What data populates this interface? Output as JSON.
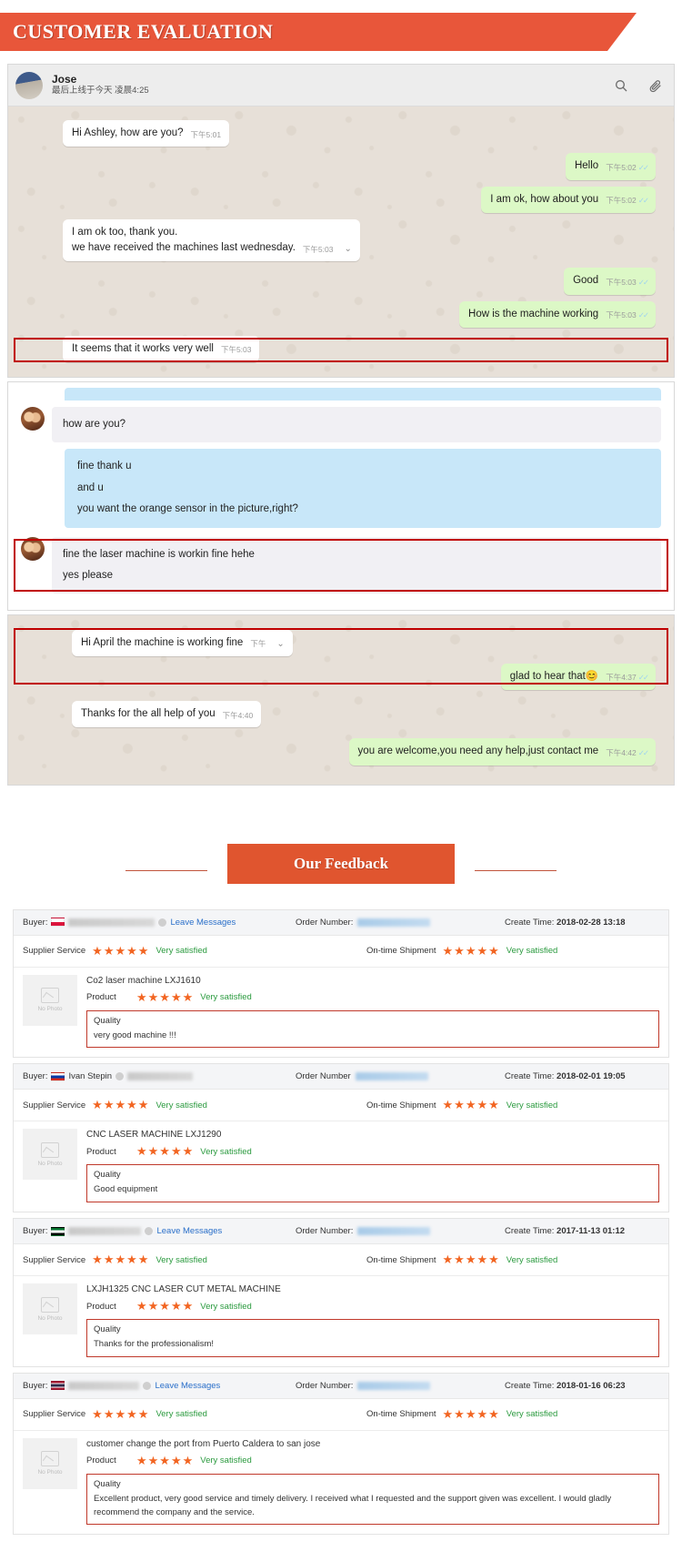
{
  "banner": {
    "title": "CUSTOMER EVALUATION"
  },
  "chat1": {
    "header": {
      "name": "Jose",
      "status": "最后上线于今天 凌晨4:25",
      "search_icon": "search-icon",
      "attach_icon": "paperclip-icon"
    },
    "messages": [
      {
        "side": "in",
        "text": "Hi Ashley, how are you?",
        "time": "下午5:01",
        "ticks": ""
      },
      {
        "side": "out",
        "text": "Hello",
        "time": "下午5:02",
        "ticks": "✓✓"
      },
      {
        "side": "out",
        "text": "I am ok, how about you",
        "time": "下午5:02",
        "ticks": "✓✓"
      },
      {
        "side": "in",
        "text": "I am ok too, thank you.\nwe have received the machines last wednesday.",
        "time": "下午5:03",
        "ticks": "",
        "chevron": "⌄"
      },
      {
        "side": "out",
        "text": "Good",
        "time": "下午5:03",
        "ticks": "✓✓"
      },
      {
        "side": "out",
        "text": "How is the machine working",
        "time": "下午5:03",
        "ticks": "✓✓"
      },
      {
        "side": "in",
        "text": "It seems that it works very well",
        "time": "下午5:03",
        "ticks": "",
        "highlight": true
      }
    ]
  },
  "chat2": {
    "messages": [
      {
        "side": "in",
        "text": "how are you?"
      },
      {
        "side": "out",
        "text": "fine thank u\nand u\nyou want the orange sensor in the picture,right?"
      },
      {
        "side": "in",
        "text": "fine the laser machine is workin fine hehe\nyes please",
        "highlight": true
      }
    ]
  },
  "chat3": {
    "messages": [
      {
        "side": "in",
        "text": "Hi April the machine is working fine",
        "time": "下午",
        "ticks": "",
        "chevron": "⌄",
        "highlight": true
      },
      {
        "side": "out",
        "text": "glad to hear that😊",
        "time": "下午4:37",
        "ticks": "✓✓"
      },
      {
        "side": "in",
        "text": "Thanks for the all help of you",
        "time": "下午4:40",
        "ticks": ""
      },
      {
        "side": "out",
        "text": "you are welcome,you need any help,just contact me",
        "time": "下午4:42",
        "ticks": "✓✓"
      }
    ]
  },
  "feedback_heading": {
    "title": "Our Feedback"
  },
  "labels": {
    "buyer": "Buyer:",
    "leave_messages": "Leave Messages",
    "order_number": "Order Number:",
    "order_number_alt": "Order Number",
    "create_time": "Create Time:",
    "supplier_service": "Supplier Service",
    "on_time_shipment": "On-time Shipment",
    "product": "Product",
    "quality": "Quality",
    "no_photo": "No Photo",
    "stars": "★★★★★",
    "very_satisfied": "Very satisfied"
  },
  "colors": {
    "accent": "#E0552F",
    "star": "#F26522",
    "good": "#2a9a3e",
    "highlight": "#c0392b",
    "link": "#2a6fc9"
  },
  "cards": [
    {
      "buyer_name": "",
      "buyer_blurred": true,
      "flag": "poland",
      "flag_colors": [
        "#ffffff",
        "#dc143c"
      ],
      "leave_messages_visible": true,
      "order_label": "Order Number:",
      "create_time": "2018-02-28 13:18",
      "supplier_service": {
        "stars": 5,
        "text": "Very satisfied"
      },
      "on_time_shipment": {
        "stars": 5,
        "text": "Very satisfied"
      },
      "product_name": "Co2 laser machine LXJ1610",
      "product_rating": {
        "stars": 5,
        "text": "Very satisfied"
      },
      "quality_text": "very good machine !!!"
    },
    {
      "buyer_name": "Ivan Stepin",
      "buyer_blurred": false,
      "flag": "russia",
      "flag_colors": [
        "#ffffff",
        "#0039a6",
        "#d52b1e"
      ],
      "leave_messages_visible": false,
      "order_label": "Order Number",
      "create_time": "2018-02-01 19:05",
      "supplier_service": {
        "stars": 5,
        "text": "Very satisfied"
      },
      "on_time_shipment": {
        "stars": 5,
        "text": "Very satisfied"
      },
      "product_name": "CNC LASER MACHINE LXJ1290",
      "product_rating": {
        "stars": 5,
        "text": "Very satisfied"
      },
      "quality_text": "Good equipment"
    },
    {
      "buyer_name": "",
      "buyer_blurred": true,
      "flag": "uae",
      "flag_colors": [
        "#00732f",
        "#ffffff",
        "#000000"
      ],
      "leave_messages_visible": true,
      "order_label": "Order Number:",
      "create_time": "2017-11-13 01:12",
      "supplier_service": {
        "stars": 5,
        "text": "Very satisfied"
      },
      "on_time_shipment": {
        "stars": 5,
        "text": "Very satisfied"
      },
      "product_name": "LXJH1325 CNC LASER CUT METAL MACHINE",
      "product_rating": {
        "stars": 5,
        "text": "Very satisfied"
      },
      "quality_text": "Thanks for the professionalism!"
    },
    {
      "buyer_name": "",
      "buyer_blurred": true,
      "flag": "thailand",
      "flag_colors": [
        "#a51931",
        "#ffffff",
        "#2d2a4a"
      ],
      "leave_messages_visible": true,
      "order_label": "Order Number:",
      "create_time": "2018-01-16 06:23",
      "supplier_service": {
        "stars": 5,
        "text": "Very satisfied"
      },
      "on_time_shipment": {
        "stars": 5,
        "text": "Very satisfied"
      },
      "product_name": "customer change the port from Puerto Caldera to san jose",
      "product_rating": {
        "stars": 5,
        "text": "Very satisfied"
      },
      "quality_text": "Excellent product, very good service and timely delivery. I received what I requested and the support given was excellent. I would gladly recommend the company and the service."
    }
  ]
}
